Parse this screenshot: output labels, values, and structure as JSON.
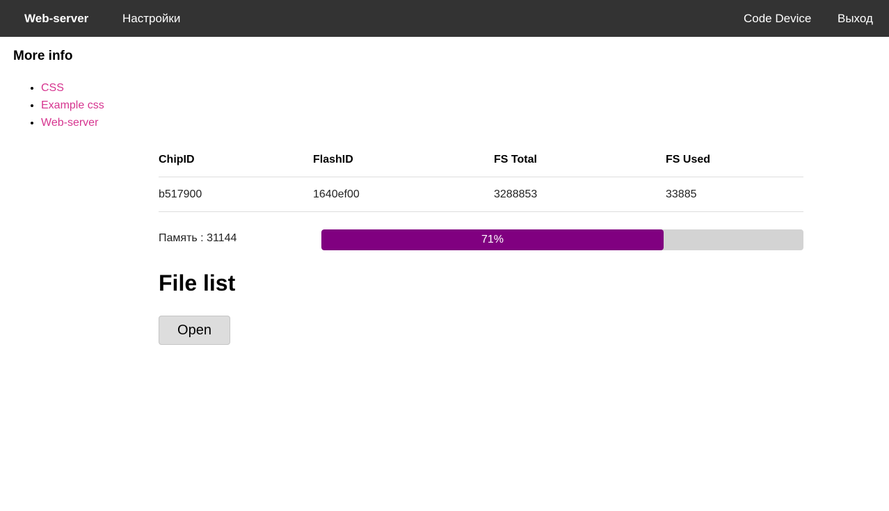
{
  "nav": {
    "brand": "Web-server",
    "settings": "Настройки",
    "code_device": "Code Device",
    "exit": "Выход"
  },
  "sidebar": {
    "title": "More info",
    "links": [
      {
        "label": "CSS"
      },
      {
        "label": "Example css"
      },
      {
        "label": "Web-server"
      }
    ],
    "link_color": "#d6348f"
  },
  "info_table": {
    "headers": [
      "ChipID",
      "FlashID",
      "FS Total",
      "FS Used"
    ],
    "row": [
      "b517900",
      "1640ef00",
      "3288853",
      "33885"
    ]
  },
  "memory": {
    "label": "Память : 31144",
    "progress_text": "71%",
    "progress_value": 0.71,
    "fill_color": "#800080",
    "track_color": "#d3d3d3"
  },
  "files": {
    "title": "File list",
    "open_label": "Open"
  },
  "colors": {
    "nav_background": "#333333",
    "nav_text": "#ffffff"
  }
}
